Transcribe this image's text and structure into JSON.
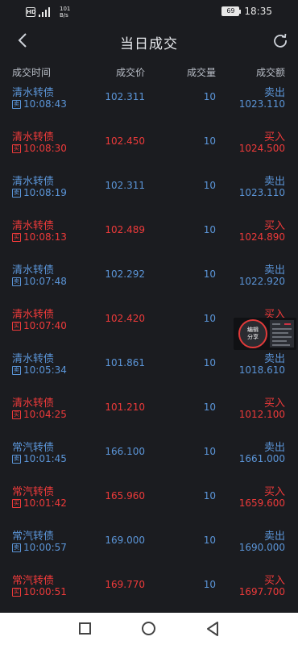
{
  "status_bar": {
    "hd": "HD",
    "signal": "4G",
    "speed_value": "101",
    "speed_unit": "B/s",
    "battery": "69",
    "time": "18:35"
  },
  "header": {
    "title": "当日成交",
    "back_icon": "chevron-left-icon",
    "refresh_icon": "refresh-icon"
  },
  "columns": {
    "time": "成交时间",
    "price": "成交价",
    "quantity": "成交量",
    "amount": "成交额"
  },
  "trades": [
    {
      "name": "清水转债",
      "mark": "卖",
      "time": "10:08:43",
      "price": "102.311",
      "quantity": "10",
      "side": "卖出",
      "amount": "1023.110",
      "type": "sell"
    },
    {
      "name": "清水转债",
      "mark": "买",
      "time": "10:08:30",
      "price": "102.450",
      "quantity": "10",
      "side": "买入",
      "amount": "1024.500",
      "type": "buy"
    },
    {
      "name": "清水转债",
      "mark": "卖",
      "time": "10:08:19",
      "price": "102.311",
      "quantity": "10",
      "side": "卖出",
      "amount": "1023.110",
      "type": "sell"
    },
    {
      "name": "清水转债",
      "mark": "买",
      "time": "10:08:13",
      "price": "102.489",
      "quantity": "10",
      "side": "买入",
      "amount": "1024.890",
      "type": "buy"
    },
    {
      "name": "清水转债",
      "mark": "卖",
      "time": "10:07:48",
      "price": "102.292",
      "quantity": "10",
      "side": "卖出",
      "amount": "1022.920",
      "type": "sell"
    },
    {
      "name": "清水转债",
      "mark": "买",
      "time": "10:07:40",
      "price": "102.420",
      "quantity": "10",
      "side": "买入",
      "amount": "",
      "type": "buy"
    },
    {
      "name": "清水转债",
      "mark": "卖",
      "time": "10:05:34",
      "price": "101.861",
      "quantity": "10",
      "side": "卖出",
      "amount": "1018.610",
      "type": "sell"
    },
    {
      "name": "清水转债",
      "mark": "买",
      "time": "10:04:25",
      "price": "101.210",
      "quantity": "10",
      "side": "买入",
      "amount": "1012.100",
      "type": "buy"
    },
    {
      "name": "常汽转债",
      "mark": "卖",
      "time": "10:01:45",
      "price": "166.100",
      "quantity": "10",
      "side": "卖出",
      "amount": "1661.000",
      "type": "sell"
    },
    {
      "name": "常汽转债",
      "mark": "买",
      "time": "10:01:42",
      "price": "165.960",
      "quantity": "10",
      "side": "买入",
      "amount": "1659.600",
      "type": "buy"
    },
    {
      "name": "常汽转债",
      "mark": "卖",
      "time": "10:00:57",
      "price": "169.000",
      "quantity": "10",
      "side": "卖出",
      "amount": "1690.000",
      "type": "sell"
    },
    {
      "name": "常汽转债",
      "mark": "买",
      "time": "10:00:51",
      "price": "169.770",
      "quantity": "10",
      "side": "买入",
      "amount": "1697.700",
      "type": "buy"
    }
  ],
  "share_widget": {
    "label_line1": "编辑",
    "label_line2": "分享"
  },
  "colors": {
    "background": "#1b1c20",
    "sell": "#5b95d8",
    "buy": "#ee3a3a"
  }
}
